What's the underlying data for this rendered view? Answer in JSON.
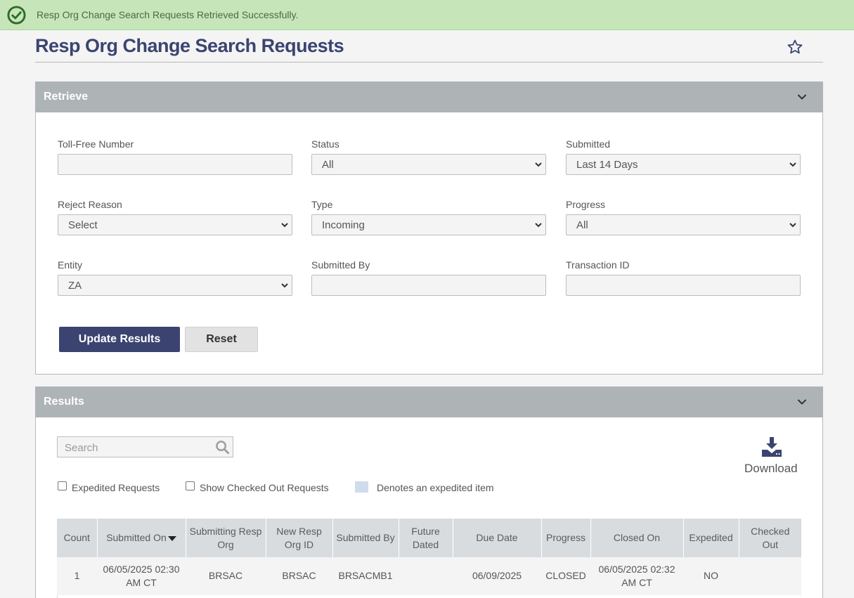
{
  "alert": {
    "message": "Resp Org Change Search Requests Retrieved Successfully."
  },
  "page": {
    "title": "Resp Org Change Search Requests"
  },
  "retrieve": {
    "title": "Retrieve",
    "fields": {
      "toll_free_number": {
        "label": "Toll-Free Number",
        "value": ""
      },
      "status": {
        "label": "Status",
        "value": "All"
      },
      "submitted": {
        "label": "Submitted",
        "value": "Last 14 Days"
      },
      "reject_reason": {
        "label": "Reject Reason",
        "value": "Select"
      },
      "type": {
        "label": "Type",
        "value": "Incoming"
      },
      "progress": {
        "label": "Progress",
        "value": "All"
      },
      "entity": {
        "label": "Entity",
        "value": "ZA"
      },
      "submitted_by": {
        "label": "Submitted By",
        "value": ""
      },
      "transaction_id": {
        "label": "Transaction ID",
        "value": ""
      }
    },
    "buttons": {
      "update": "Update Results",
      "reset": "Reset"
    }
  },
  "results": {
    "title": "Results",
    "search_placeholder": "Search",
    "download_label": "Download",
    "expedited_requests_label": "Expedited Requests",
    "show_checked_out_label": "Show Checked Out Requests",
    "legend_label": "Denotes an expedited item",
    "legend_color": "#cfdceb",
    "columns": [
      "Count",
      "Submitted On",
      "Submitting Resp Org",
      "New Resp Org ID",
      "Submitted By",
      "Future Dated",
      "Due Date",
      "Progress",
      "Closed On",
      "Expedited",
      "Checked Out"
    ],
    "rows": [
      {
        "count": "1",
        "submitted_on": "06/05/2025 02:30 AM CT",
        "submitting_resp_org": "BRSAC",
        "new_resp_org_id": "BRSAC",
        "submitted_by": "BRSACMB1",
        "future_dated": "",
        "due_date": "06/09/2025",
        "progress": "CLOSED",
        "closed_on": "06/05/2025 02:32 AM CT",
        "expedited": "NO",
        "checked_out": ""
      }
    ]
  },
  "colors": {
    "brand": "#3b4470",
    "panel_header": "#aeb3b6",
    "success_bg": "#c6e6b9",
    "success_icon": "#2f6b2a"
  }
}
